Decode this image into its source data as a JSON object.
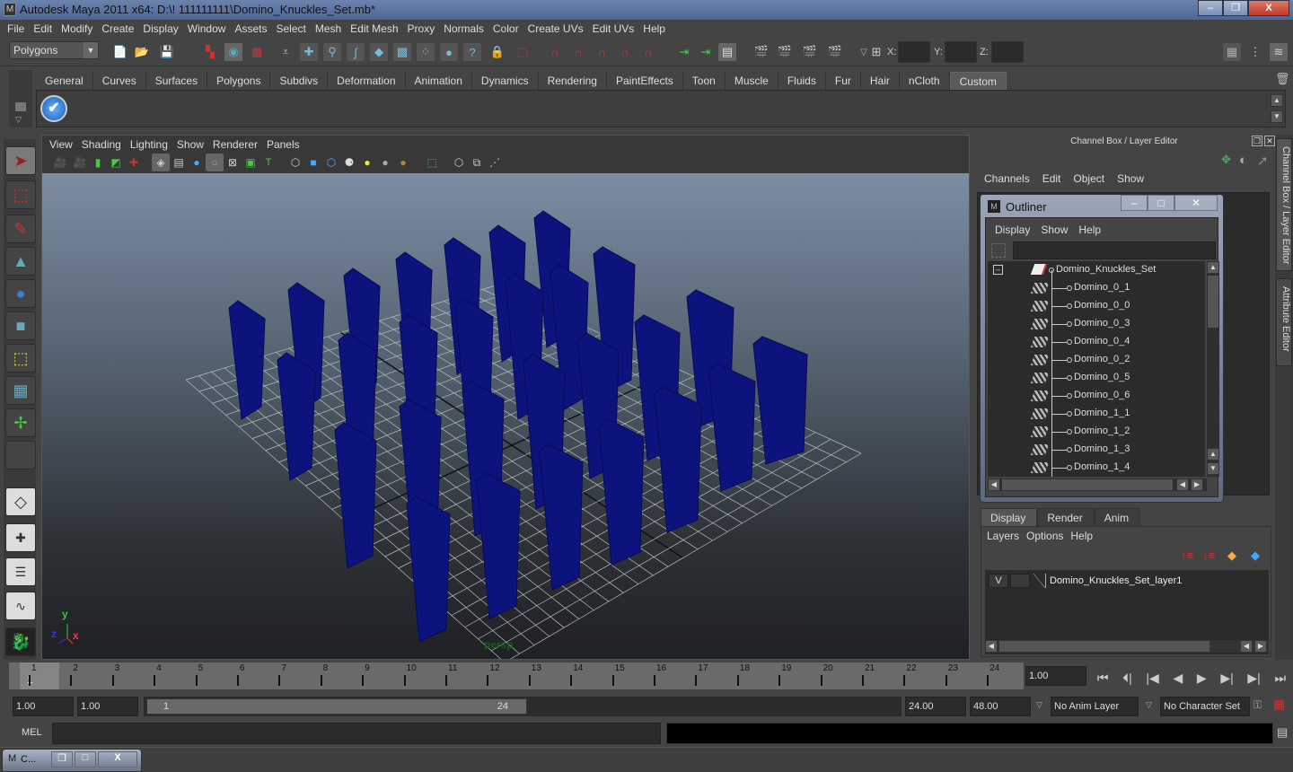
{
  "window": {
    "title": "Autodesk Maya 2011 x64: D:\\! 111111111\\Domino_Knuckles_Set.mb*",
    "minimize": "–",
    "maximize": "❐",
    "close": "X"
  },
  "menubar": [
    "File",
    "Edit",
    "Modify",
    "Create",
    "Display",
    "Window",
    "Assets",
    "Select",
    "Mesh",
    "Edit Mesh",
    "Proxy",
    "Normals",
    "Color",
    "Create UVs",
    "Edit UVs",
    "Help"
  ],
  "toolbar": {
    "mode": "Polygons",
    "x_label": "X:",
    "y_label": "Y:",
    "z_label": "Z:",
    "x_value": "",
    "y_value": "",
    "z_value": ""
  },
  "shelf": {
    "tabs": [
      "General",
      "Curves",
      "Surfaces",
      "Polygons",
      "Subdivs",
      "Deformation",
      "Animation",
      "Dynamics",
      "Rendering",
      "PaintEffects",
      "Toon",
      "Muscle",
      "Fluids",
      "Fur",
      "Hair",
      "nCloth",
      "Custom"
    ],
    "active_tab": "Custom"
  },
  "viewport": {
    "menu": [
      "View",
      "Shading",
      "Lighting",
      "Show",
      "Renderer",
      "Panels"
    ],
    "camera": "persp",
    "axis": {
      "x": "x",
      "y": "y",
      "z": "z"
    }
  },
  "channel_box": {
    "header": "Channel Box / Layer Editor",
    "menu": [
      "Channels",
      "Edit",
      "Object",
      "Show"
    ]
  },
  "side_tabs": [
    "Channel Box / Layer Editor",
    "Attribute Editor"
  ],
  "outliner": {
    "title": "Outliner",
    "menu": [
      "Display",
      "Show",
      "Help"
    ],
    "filter": "",
    "root": "Domino_Knuckles_Set",
    "items": [
      "Domino_0_1",
      "Domino_0_0",
      "Domino_0_3",
      "Domino_0_4",
      "Domino_0_2",
      "Domino_0_5",
      "Domino_0_6",
      "Domino_1_1",
      "Domino_1_2",
      "Domino_1_3",
      "Domino_1_4"
    ]
  },
  "layer_editor": {
    "tabs": [
      "Display",
      "Render",
      "Anim"
    ],
    "active_tab": "Display",
    "menu": [
      "Layers",
      "Options",
      "Help"
    ],
    "layers": [
      {
        "visible": "V",
        "name": "Domino_Knuckles_Set_layer1"
      }
    ]
  },
  "timeline": {
    "ticks": [
      "1",
      "2",
      "3",
      "4",
      "5",
      "6",
      "7",
      "8",
      "9",
      "10",
      "11",
      "12",
      "13",
      "14",
      "15",
      "16",
      "17",
      "18",
      "19",
      "20",
      "21",
      "22",
      "23",
      "24"
    ],
    "current_marker": "1",
    "current_frame": "1.00"
  },
  "range": {
    "start": "1.00",
    "anim_start": "1.00",
    "slider_start": "1",
    "slider_end": "24",
    "end": "24.00",
    "anim_end": "48.00",
    "anim_layer": "No Anim Layer",
    "character_set": "No Character Set"
  },
  "command_line": {
    "label": "MEL",
    "input": "",
    "output": ""
  },
  "minimized_window": {
    "label": "C..."
  }
}
